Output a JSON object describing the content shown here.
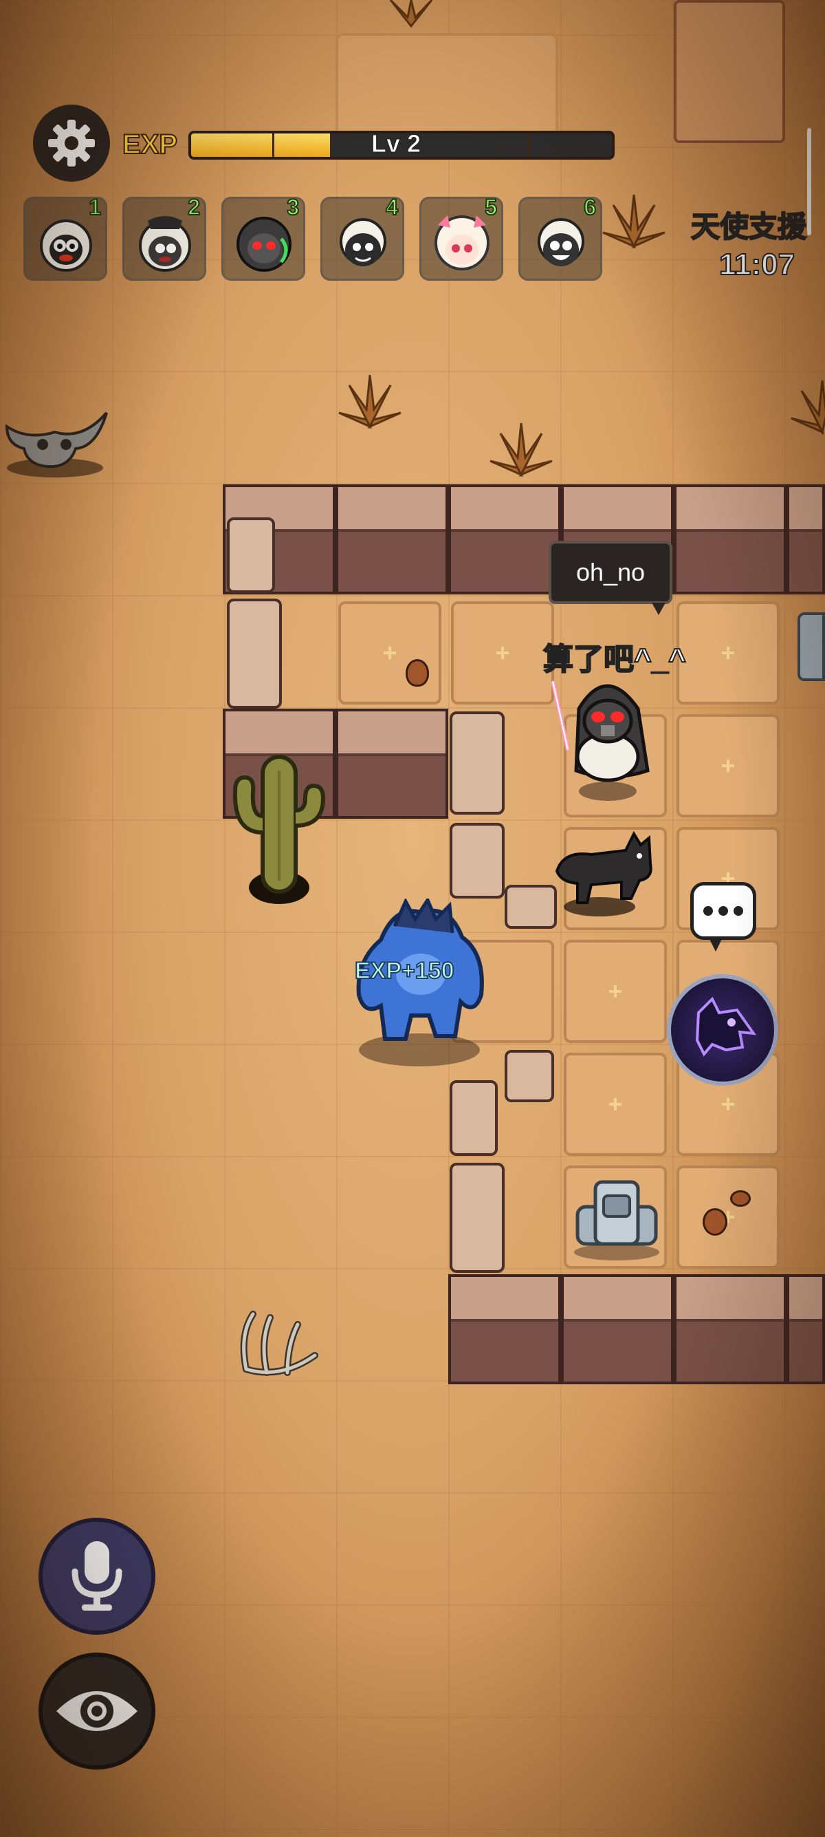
{
  "hud": {
    "exp_label": "EXP",
    "level": "Lv 2",
    "exp_progress": 0.33,
    "player_slots": [
      {
        "number": "1",
        "avatar": "white-sheep-avatar"
      },
      {
        "number": "2",
        "avatar": "masked-sheep-avatar"
      },
      {
        "number": "3",
        "avatar": "reaper-sheep-avatar"
      },
      {
        "number": "4",
        "avatar": "black-sheep-avatar"
      },
      {
        "number": "5",
        "avatar": "pink-sheep-avatar"
      },
      {
        "number": "6",
        "avatar": "grey-sheep-avatar"
      }
    ],
    "angel_support": {
      "title": "天使支援",
      "timer": "11:07"
    }
  },
  "world": {
    "player_name": "oh_no",
    "player_speech": "算了吧^_^",
    "exp_gain": "EXP+150"
  },
  "controls": {
    "chat": "chat-bubble-icon",
    "wolf_skill": "wolf-skill-icon",
    "mic": "microphone-icon",
    "view": "eye-icon"
  },
  "colors": {
    "exp_fill": "#f0a818",
    "slot_number": "#9ef07a",
    "skill_ring": "#9aa3bb"
  }
}
